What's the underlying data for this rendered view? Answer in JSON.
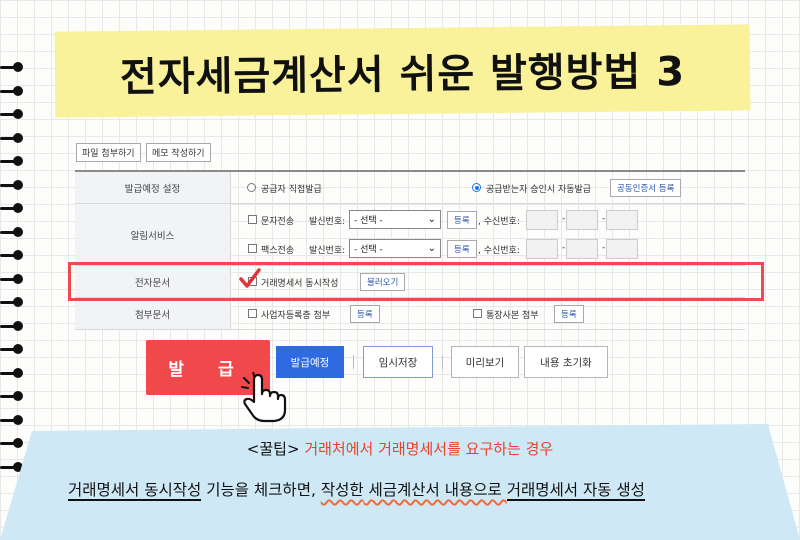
{
  "title": "전자세금계산서 쉬운 발행방법 3",
  "toolbar": {
    "attach_file": "파일 첨부하기",
    "write_memo": "메모 작성하기"
  },
  "rows": {
    "issue_setting": {
      "label": "발급예정 설정",
      "option_direct": "공급자 직접발급",
      "option_approval": "공급받는자 승인시 자동발급",
      "register_cert": "공동인증서 등록",
      "selected": "공급받는자 승인시 자동발급"
    },
    "notify": {
      "label": "알림서비스",
      "sms": "문자전송",
      "fax": "팩스전송",
      "sender_label": "발신번호:",
      "select_value": "- 선택 -",
      "register": "등록",
      "receiver_label": ", 수신번호:",
      "dash": "-"
    },
    "edoc": {
      "label": "전자문서",
      "option": "거래명세서 동시작성",
      "load": "불러오기"
    },
    "attach": {
      "label": "첨부문서",
      "biz_reg": "사업자등록증 첨부",
      "bank_copy": "통장사본 첨부",
      "register": "등록"
    }
  },
  "actions": {
    "issue": "발 급",
    "planned": "발급예정",
    "temp_save": "임시저장",
    "preview": "미리보기",
    "reset": "내용 초기화"
  },
  "tip": {
    "head": "<꿀팁>",
    "condition": "거래처에서 거래명세서를 요구하는 경우",
    "line2_a": "거래명세서 동시작성",
    "line2_b": " 기능을 체크하면, ",
    "line2_c": "작성한",
    "line2_d": " 세금계산서 내용으로 ",
    "line2_e": "거래명세서 자동 생성"
  },
  "colors": {
    "banner": "#faf29a",
    "highlight": "#ef4a4f",
    "issue_button": "#f0484b",
    "planned_button": "#2e6ae0",
    "tip_background": "#cfe8f6",
    "tip_accent": "#e8432d"
  }
}
